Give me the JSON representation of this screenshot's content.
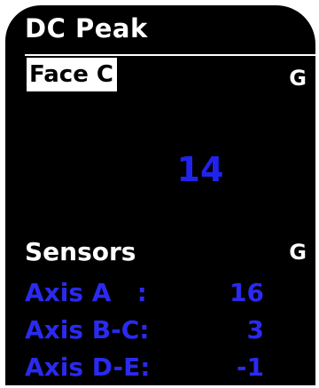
{
  "screen": {
    "title": "DC Peak",
    "face": {
      "label": "Face C",
      "unit": "G",
      "value": "14"
    },
    "sensors": {
      "label": "Sensors",
      "unit": "G",
      "rows": [
        {
          "name": "Axis A   :",
          "value": "16"
        },
        {
          "name": "Axis B-C:",
          "value": "3"
        },
        {
          "name": "Axis D-E:",
          "value": "-1"
        }
      ]
    }
  },
  "colors": {
    "background": "#000000",
    "text_primary": "#ffffff",
    "text_accent": "#2a2af0"
  }
}
